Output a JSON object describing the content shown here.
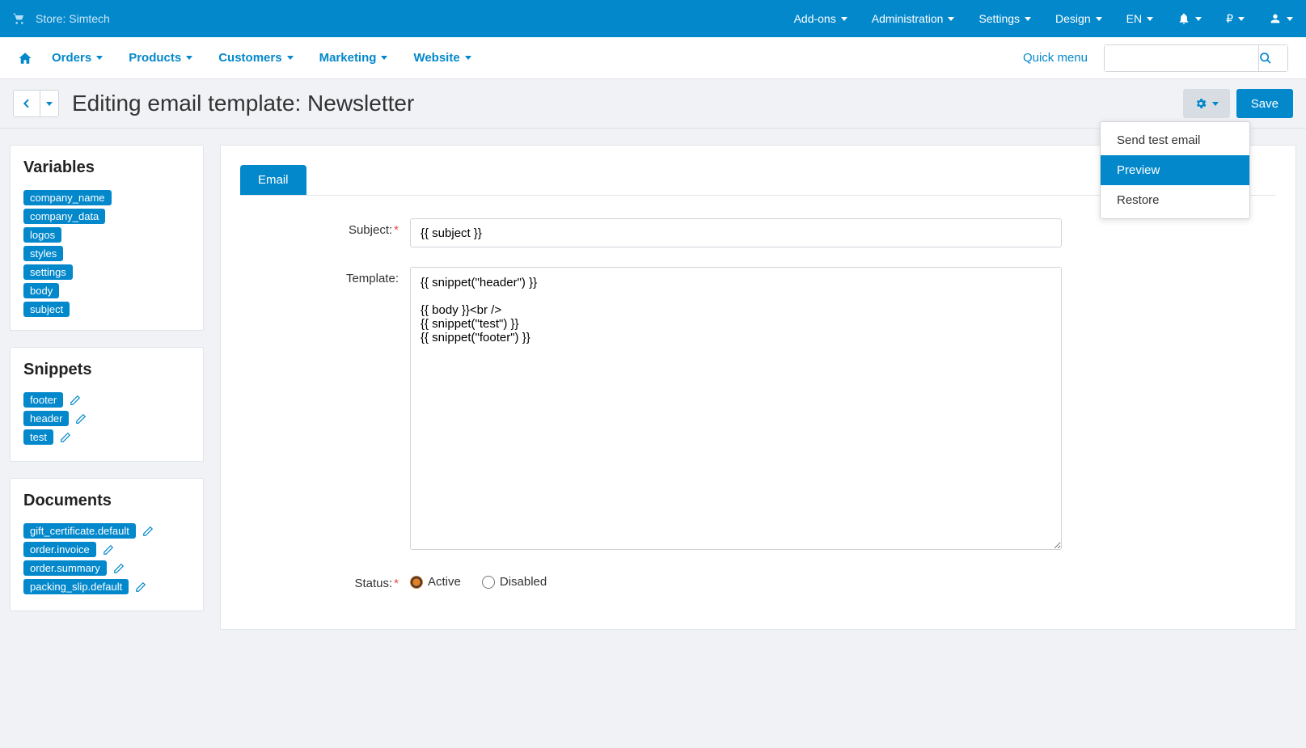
{
  "topbar": {
    "store_label": "Store: Simtech",
    "items": [
      "Add-ons",
      "Administration",
      "Settings",
      "Design",
      "EN"
    ],
    "currency": "₽"
  },
  "menubar": {
    "items": [
      "Orders",
      "Products",
      "Customers",
      "Marketing",
      "Website"
    ],
    "quick_menu": "Quick menu"
  },
  "page": {
    "title": "Editing email template: Newsletter",
    "save_label": "Save"
  },
  "dropdown": {
    "items": [
      "Send test email",
      "Preview",
      "Restore"
    ],
    "active_index": 1
  },
  "sidebar": {
    "variables": {
      "title": "Variables",
      "items": [
        "company_name",
        "company_data",
        "logos",
        "styles",
        "settings",
        "body",
        "subject"
      ]
    },
    "snippets": {
      "title": "Snippets",
      "items": [
        "footer",
        "header",
        "test"
      ]
    },
    "documents": {
      "title": "Documents",
      "items": [
        "gift_certificate.default",
        "order.invoice",
        "order.summary",
        "packing_slip.default"
      ]
    }
  },
  "form": {
    "tab": "Email",
    "subject_label": "Subject:",
    "subject_value": "{{ subject }}",
    "template_label": "Template:",
    "template_value": "{{ snippet(\"header\") }}\n\n{{ body }}<br />\n{{ snippet(\"test\") }}\n{{ snippet(\"footer\") }}",
    "status_label": "Status:",
    "status_active": "Active",
    "status_disabled": "Disabled"
  }
}
